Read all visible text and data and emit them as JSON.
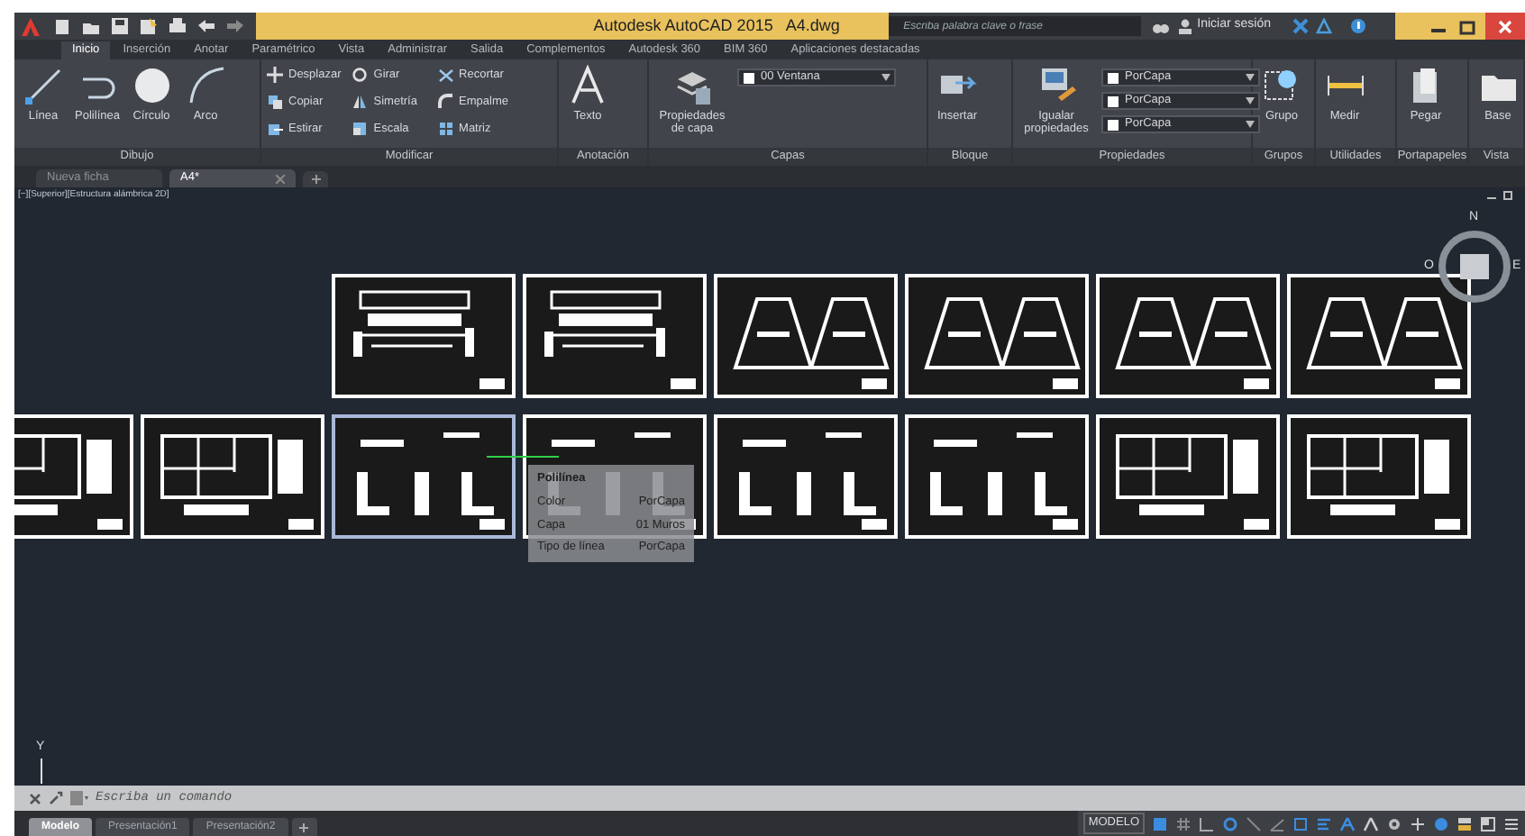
{
  "window": {
    "title": "Autodesk AutoCAD 2015   A4.dwg",
    "search": {
      "placeholder": "Escriba palabra clave o frase"
    },
    "sign_in": "Iniciar sesión"
  },
  "ribbon_tabs": [
    {
      "label": "Inicio",
      "selected": true
    },
    {
      "label": "Inserción",
      "selected": false
    },
    {
      "label": "Anotar",
      "selected": false
    },
    {
      "label": "Paramétrico",
      "selected": false
    },
    {
      "label": "Vista",
      "selected": false
    },
    {
      "label": "Administrar",
      "selected": false
    },
    {
      "label": "Salida",
      "selected": false
    },
    {
      "label": "Complementos",
      "selected": false
    },
    {
      "label": "Autodesk 360",
      "selected": false
    },
    {
      "label": "BIM 360",
      "selected": false
    },
    {
      "label": "Aplicaciones destacadas",
      "selected": false
    }
  ],
  "panels": [
    {
      "label": "Dibujo",
      "tools": [
        {
          "kind": "large",
          "label": "Línea"
        },
        {
          "kind": "large",
          "label": "Polilínea"
        },
        {
          "kind": "large",
          "label": "Círculo"
        },
        {
          "kind": "large",
          "label": "Arco"
        }
      ]
    },
    {
      "label": "Modificar",
      "tools": [
        {
          "kind": "small",
          "label": "Desplazar"
        },
        {
          "kind": "small",
          "label": "Girar"
        },
        {
          "kind": "small",
          "label": "Recortar"
        },
        {
          "kind": "small",
          "label": "Copiar"
        },
        {
          "kind": "small",
          "label": "Simetría"
        },
        {
          "kind": "small",
          "label": "Empalme"
        },
        {
          "kind": "small",
          "label": "Estirar"
        },
        {
          "kind": "small",
          "label": "Escala"
        },
        {
          "kind": "small",
          "label": "Matriz"
        }
      ]
    },
    {
      "label": "Anotación",
      "tools": [
        {
          "kind": "large",
          "label": "Texto"
        }
      ]
    },
    {
      "label": "Capas",
      "tools": [
        {
          "kind": "large",
          "label": "Propiedades de capa"
        },
        {
          "kind": "dropdown",
          "label": "00 Ventana"
        }
      ]
    },
    {
      "label": "Bloque",
      "tools": [
        {
          "kind": "large",
          "label": "Insertar"
        }
      ]
    },
    {
      "label": "Propiedades",
      "tools": [
        {
          "kind": "large",
          "label": "Igualar propiedades"
        },
        {
          "kind": "dropdown",
          "label": "PorCapa"
        },
        {
          "kind": "dropdown",
          "label": "PorCapa"
        },
        {
          "kind": "dropdown",
          "label": "PorCapa"
        }
      ]
    },
    {
      "label": "Grupos",
      "tools": [
        {
          "kind": "large",
          "label": "Grupo"
        }
      ]
    },
    {
      "label": "Utilidades",
      "tools": [
        {
          "kind": "large",
          "label": "Medir"
        }
      ]
    },
    {
      "label": "Portapapeles",
      "tools": [
        {
          "kind": "large",
          "label": "Pegar"
        }
      ]
    },
    {
      "label": "Vista",
      "tools": [
        {
          "kind": "large",
          "label": "Base"
        }
      ]
    }
  ],
  "document_tabs": [
    {
      "label": "Nueva ficha",
      "selected": false
    },
    {
      "label": "A4*",
      "selected": true
    }
  ],
  "viewport_label": "[−][Superior][Estructura alámbrica 2D]",
  "sheet_rows": [
    [
      {
        "kind": "elevation",
        "highlighted": false
      },
      {
        "kind": "elevation",
        "highlighted": false
      },
      {
        "kind": "section",
        "highlighted": false
      },
      {
        "kind": "section",
        "highlighted": false
      },
      {
        "kind": "section",
        "highlighted": false
      },
      {
        "kind": "section",
        "highlighted": false
      }
    ],
    [
      {
        "kind": "plan",
        "highlighted": false
      },
      {
        "kind": "plan",
        "highlighted": false
      },
      {
        "kind": "detail",
        "highlighted": true
      },
      {
        "kind": "detail",
        "highlighted": false
      },
      {
        "kind": "detail",
        "highlighted": false
      },
      {
        "kind": "detail",
        "highlighted": false
      },
      {
        "kind": "plan",
        "highlighted": false
      },
      {
        "kind": "plan",
        "highlighted": false
      }
    ]
  ],
  "tooltip": {
    "title": "Polilínea",
    "rows": [
      {
        "label": "Color",
        "value": "PorCapa"
      },
      {
        "label": "Capa",
        "value": "01 Muros"
      },
      {
        "label": "Tipo de línea",
        "value": "PorCapa"
      }
    ]
  },
  "viewcube": {
    "north": "N",
    "west": "O",
    "east": "E"
  },
  "ucs": {
    "y_label": "Y"
  },
  "command_line": {
    "placeholder": "Escriba un comando"
  },
  "layout_tabs": [
    {
      "label": "Modelo",
      "selected": true
    },
    {
      "label": "Presentación1",
      "selected": false
    },
    {
      "label": "Presentación2",
      "selected": false
    }
  ],
  "status_bar": {
    "space": "MODELO"
  }
}
